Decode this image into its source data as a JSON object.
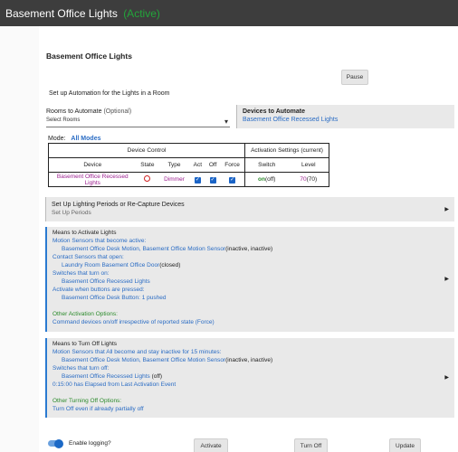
{
  "app": {
    "title": "Basement Office Lights",
    "status": "(Active)"
  },
  "page_title": "Basement Office Lights",
  "pause_label": "Pause",
  "section_title": "Set up Automation for the Lights in a Room",
  "rooms": {
    "label": "Rooms to Automate",
    "optional": "(Optional)",
    "placeholder": "Select Rooms"
  },
  "devices_panel": {
    "title": "Devices to Automate",
    "value": "Basement Office Recessed Lights"
  },
  "mode": {
    "label": "Mode:",
    "value": "All Modes"
  },
  "table": {
    "group1": "Device Control",
    "group2": "Activation Settings (current)",
    "headers": [
      "Device",
      "State",
      "Type",
      "Act",
      "Off",
      "Force",
      "Switch",
      "Level"
    ],
    "row": {
      "device": "Basement Office Recessed Lights",
      "type": "Dimmer",
      "switch_on": "on",
      "switch_current": "(off)",
      "level": "70",
      "level_current": "(70)"
    }
  },
  "periods": {
    "title": "Set Up Lighting Periods or Re-Capture Devices",
    "sub": "Set Up Periods"
  },
  "activate_panel": {
    "title": "Means to Activate Lights",
    "line1": "Motion Sensors that become active:",
    "line2": "Basement Office Desk Motion, Basement Office Motion Sensor",
    "line2b": "(inactive, inactive)",
    "line3": "Contact Sensors that open:",
    "line4": "Laundry Room Basement Office Door",
    "line4b": "(closed)",
    "line5": "Switches that turn on:",
    "line6": "Basement Office Recessed Lights",
    "line7": "Activate when buttons are pressed:",
    "line8": "Basement Office Desk Button: 1 pushed",
    "line9": "Other Activation Options:",
    "line10": "Command devices on/off irrespective of reported state (Force)"
  },
  "off_panel": {
    "title": "Means to Turn Off Lights",
    "line1": "Motion Sensors that All become and stay inactive for 15 minutes:",
    "line2": "Basement Office Desk Motion, Basement Office Motion Sensor",
    "line2b": "(inactive, inactive)",
    "line3": "Switches that turn off:",
    "line4": "Basement Office Recessed Lights",
    "line4b": "(off)",
    "line5": "0:15:00 has Elapsed from Last Activation Event",
    "line6": "Other Turning Off Options:",
    "line7": "Turn Off even if already partially off"
  },
  "footer": {
    "logging_label": "Enable logging?",
    "activate": "Activate",
    "turn_off": "Turn Off",
    "update": "Update"
  }
}
